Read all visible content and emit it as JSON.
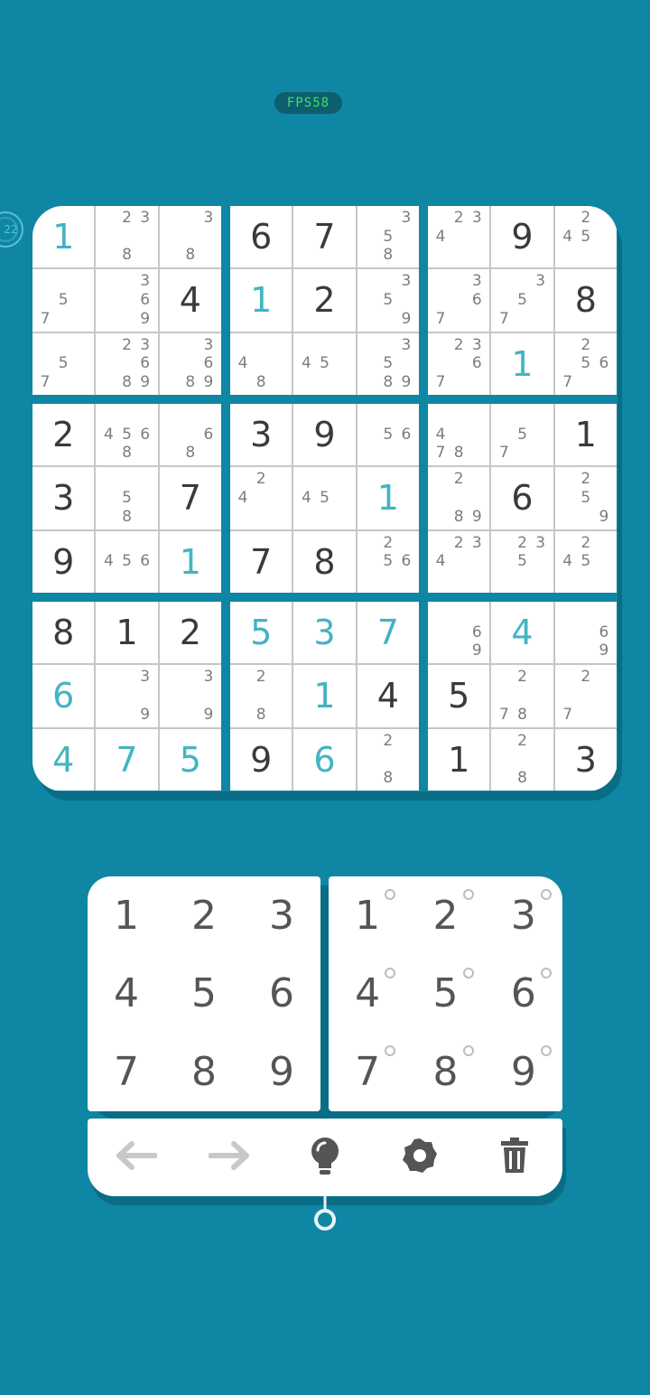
{
  "status": {
    "fps": "FPS58",
    "timer_badge": "22"
  },
  "board": [
    [
      {
        "v": 1,
        "t": "u"
      },
      {
        "n": [
          2,
          3,
          8
        ]
      },
      {
        "n": [
          3,
          8
        ]
      },
      {
        "v": 6,
        "t": "g"
      },
      {
        "v": 7,
        "t": "g"
      },
      {
        "n": [
          3,
          5,
          8
        ]
      },
      {
        "n": [
          2,
          3,
          4
        ]
      },
      {
        "v": 9,
        "t": "g"
      },
      {
        "n": [
          2,
          4,
          5
        ]
      }
    ],
    [
      {
        "n": [
          5,
          7
        ]
      },
      {
        "n": [
          3,
          6,
          9
        ]
      },
      {
        "v": 4,
        "t": "g"
      },
      {
        "v": 1,
        "t": "u"
      },
      {
        "v": 2,
        "t": "g"
      },
      {
        "n": [
          3,
          5,
          9
        ]
      },
      {
        "n": [
          3,
          6,
          7
        ]
      },
      {
        "n": [
          3,
          5,
          7
        ]
      },
      {
        "v": 8,
        "t": "g"
      }
    ],
    [
      {
        "n": [
          5,
          7
        ]
      },
      {
        "n": [
          2,
          3,
          6,
          8,
          9
        ]
      },
      {
        "n": [
          3,
          6,
          8,
          9
        ]
      },
      {
        "n": [
          4,
          8
        ]
      },
      {
        "n": [
          4,
          5
        ]
      },
      {
        "n": [
          3,
          5,
          8,
          9
        ]
      },
      {
        "n": [
          2,
          3,
          6,
          7
        ]
      },
      {
        "v": 1,
        "t": "u"
      },
      {
        "n": [
          2,
          5,
          6,
          7
        ]
      }
    ],
    [
      {
        "v": 2,
        "t": "g"
      },
      {
        "n": [
          4,
          5,
          6,
          8
        ]
      },
      {
        "n": [
          6,
          8
        ]
      },
      {
        "v": 3,
        "t": "g"
      },
      {
        "v": 9,
        "t": "g"
      },
      {
        "n": [
          5,
          6
        ]
      },
      {
        "n": [
          4,
          7,
          8
        ]
      },
      {
        "n": [
          5,
          7
        ]
      },
      {
        "v": 1,
        "t": "g"
      }
    ],
    [
      {
        "v": 3,
        "t": "g"
      },
      {
        "n": [
          5,
          8
        ]
      },
      {
        "v": 7,
        "t": "g"
      },
      {
        "n": [
          2,
          4
        ]
      },
      {
        "n": [
          4,
          5
        ]
      },
      {
        "v": 1,
        "t": "u"
      },
      {
        "n": [
          2,
          8,
          9
        ]
      },
      {
        "v": 6,
        "t": "g"
      },
      {
        "n": [
          2,
          5,
          9
        ]
      }
    ],
    [
      {
        "v": 9,
        "t": "g"
      },
      {
        "n": [
          4,
          5,
          6
        ]
      },
      {
        "v": 1,
        "t": "u"
      },
      {
        "v": 7,
        "t": "g"
      },
      {
        "v": 8,
        "t": "g"
      },
      {
        "n": [
          2,
          5,
          6
        ]
      },
      {
        "n": [
          2,
          3,
          4
        ]
      },
      {
        "n": [
          2,
          3,
          5
        ]
      },
      {
        "n": [
          2,
          4,
          5
        ]
      }
    ],
    [
      {
        "v": 8,
        "t": "g"
      },
      {
        "v": 1,
        "t": "g"
      },
      {
        "v": 2,
        "t": "g"
      },
      {
        "v": 5,
        "t": "u"
      },
      {
        "v": 3,
        "t": "u"
      },
      {
        "v": 7,
        "t": "u"
      },
      {
        "n": [
          6,
          9
        ]
      },
      {
        "v": 4,
        "t": "u"
      },
      {
        "n": [
          6,
          9
        ]
      }
    ],
    [
      {
        "v": 6,
        "t": "u"
      },
      {
        "n": [
          3,
          9
        ]
      },
      {
        "n": [
          3,
          9
        ]
      },
      {
        "n": [
          2,
          8
        ]
      },
      {
        "v": 1,
        "t": "u"
      },
      {
        "v": 4,
        "t": "g"
      },
      {
        "v": 5,
        "t": "g"
      },
      {
        "n": [
          2,
          7,
          8
        ]
      },
      {
        "n": [
          2,
          7
        ]
      }
    ],
    [
      {
        "v": 4,
        "t": "u"
      },
      {
        "v": 7,
        "t": "u"
      },
      {
        "v": 5,
        "t": "u"
      },
      {
        "v": 9,
        "t": "g"
      },
      {
        "v": 6,
        "t": "u"
      },
      {
        "n": [
          2,
          8
        ]
      },
      {
        "v": 1,
        "t": "g"
      },
      {
        "n": [
          2,
          8
        ]
      },
      {
        "v": 3,
        "t": "g"
      }
    ]
  ],
  "value_pad": [
    "1",
    "2",
    "3",
    "4",
    "5",
    "6",
    "7",
    "8",
    "9"
  ],
  "note_pad": [
    "1",
    "2",
    "3",
    "4",
    "5",
    "6",
    "7",
    "8",
    "9"
  ],
  "toolbar": [
    {
      "name": "undo-button",
      "icon": "arrow-left-icon",
      "color": "#c8c8c8"
    },
    {
      "name": "redo-button",
      "icon": "arrow-right-icon",
      "color": "#c8c8c8"
    },
    {
      "name": "hint-button",
      "icon": "lightbulb-icon",
      "color": "#555555"
    },
    {
      "name": "settings-button",
      "icon": "gear-icon",
      "color": "#555555"
    },
    {
      "name": "clear-button",
      "icon": "trash-icon",
      "color": "#555555"
    }
  ],
  "colors": {
    "background": "#0f86a4",
    "given": "#3a3a3a",
    "user": "#43b4c3",
    "note": "#7d7d7d",
    "fps": "#3fe06a"
  }
}
